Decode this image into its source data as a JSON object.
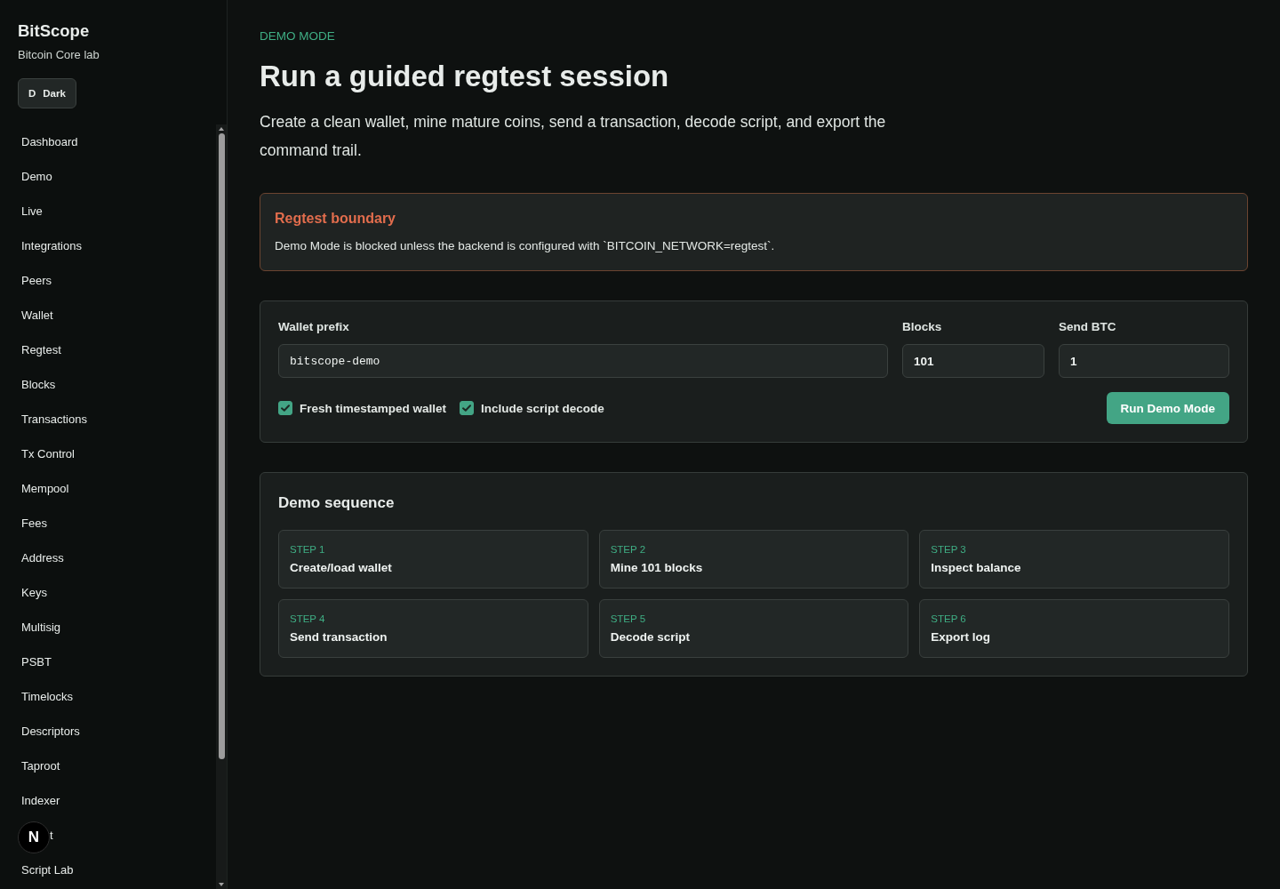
{
  "sidebar": {
    "brand": "BitScope",
    "subtitle": "Bitcoin Core lab",
    "theme_button": {
      "icon": "D",
      "label": "Dark"
    },
    "items": [
      {
        "label": "Dashboard",
        "kind": "link"
      },
      {
        "label": "Demo",
        "kind": "link"
      },
      {
        "label": "Live",
        "kind": "link"
      },
      {
        "label": "Integrations",
        "kind": "link"
      },
      {
        "label": "Peers",
        "kind": "link"
      },
      {
        "label": "Wallet",
        "kind": "link"
      },
      {
        "label": "Regtest",
        "kind": "link"
      },
      {
        "label": "Blocks",
        "kind": "link"
      },
      {
        "label": "Transactions",
        "kind": "link"
      },
      {
        "label": "Tx Control",
        "kind": "link"
      },
      {
        "label": "Mempool",
        "kind": "link"
      },
      {
        "label": "Fees",
        "kind": "link"
      },
      {
        "label": "Address",
        "kind": "link"
      },
      {
        "label": "Keys",
        "kind": "link"
      },
      {
        "label": "Multisig",
        "kind": "link"
      },
      {
        "label": "PSBT",
        "kind": "link"
      },
      {
        "label": "Timelocks",
        "kind": "link"
      },
      {
        "label": "Descriptors",
        "kind": "link"
      },
      {
        "label": "Taproot",
        "kind": "link"
      },
      {
        "label": "Indexer",
        "kind": "link"
      },
      {
        "label": "t",
        "kind": "covered"
      },
      {
        "label": "Script Lab",
        "kind": "link"
      }
    ]
  },
  "dev_indicator": {
    "label": "N"
  },
  "header": {
    "eyebrow": "DEMO MODE",
    "title": "Run a guided regtest session",
    "description": "Create a clean wallet, mine mature coins, send a transaction, decode script, and export the command trail."
  },
  "notice": {
    "title": "Regtest boundary",
    "text": "Demo Mode is blocked unless the backend is configured with `BITCOIN_NETWORK=regtest`."
  },
  "form": {
    "fields": [
      {
        "label": "Wallet prefix",
        "value": "bitscope-demo",
        "kind": "mono"
      },
      {
        "label": "Blocks",
        "value": "101",
        "kind": "plain"
      },
      {
        "label": "Send BTC",
        "value": "1",
        "kind": "plain"
      }
    ],
    "options": [
      {
        "label": "Fresh timestamped wallet",
        "checked": true
      },
      {
        "label": "Include script decode",
        "checked": true
      }
    ],
    "submit": "Run Demo Mode"
  },
  "sequence": {
    "title": "Demo sequence",
    "steps": [
      {
        "step": "STEP 1",
        "title": "Create/load wallet"
      },
      {
        "step": "STEP 2",
        "title": "Mine 101 blocks"
      },
      {
        "step": "STEP 3",
        "title": "Inspect balance"
      },
      {
        "step": "STEP 4",
        "title": "Send transaction"
      },
      {
        "step": "STEP 5",
        "title": "Decode script"
      },
      {
        "step": "STEP 6",
        "title": "Export log"
      }
    ]
  }
}
